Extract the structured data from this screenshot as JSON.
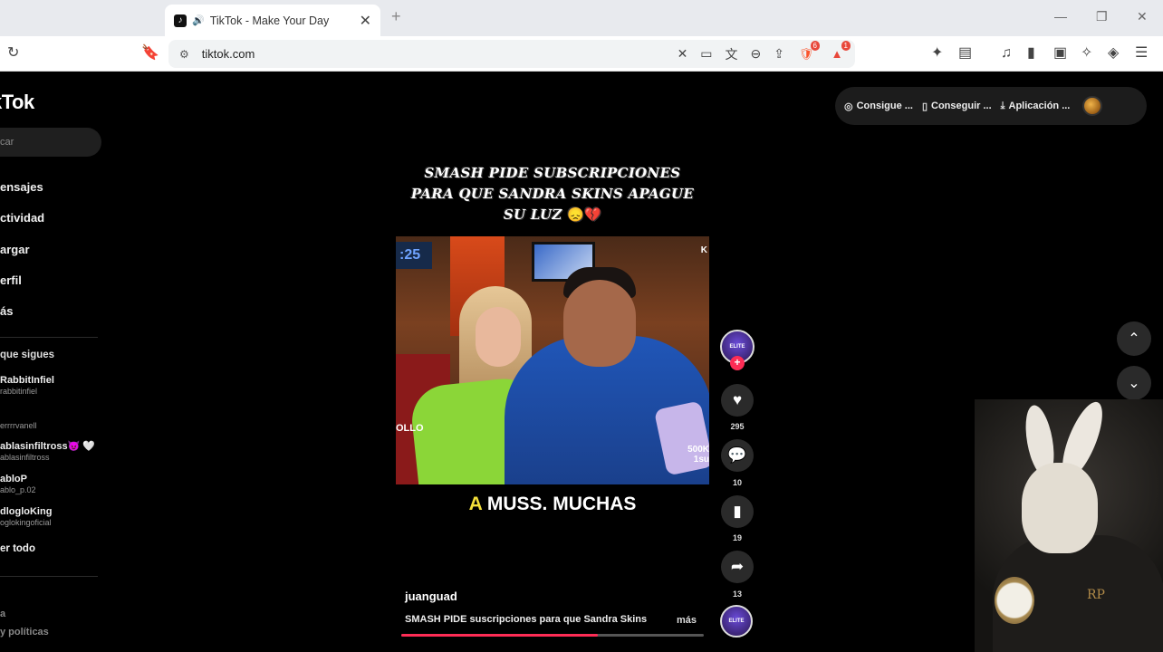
{
  "browser": {
    "tab_title": "TikTok - Make Your Day",
    "tab_close": "✕",
    "new_tab": "+",
    "url": "tiktok.com",
    "shield_badge": "6",
    "alert_badge": "1"
  },
  "sidebar": {
    "logo": "kTok",
    "search_placeholder": "car",
    "nav": [
      "ensajes",
      "ctividad",
      "argar",
      "erfil",
      "ás"
    ],
    "following_header": "que sigues",
    "accounts": [
      {
        "name": "RabbitInfiel",
        "handle": "rabbitinfiel"
      },
      {
        "name": "",
        "handle": "errrrvanell"
      },
      {
        "name": "ablasinfiltross😈 🤍",
        "handle": "ablasinfiltross"
      },
      {
        "name": "abloP",
        "handle": "ablo_p.02"
      },
      {
        "name": "dlogloKing",
        "handle": "oglokingoficial"
      }
    ],
    "see_all": "er todo",
    "footer_1": "a",
    "footer_2": "y políticas"
  },
  "top_actions": {
    "btn1": "Consigue ...",
    "btn2": "Conseguir ...",
    "btn3": "Aplicación ..."
  },
  "video": {
    "caption_line1": "SMASH PIDE SUBSCRIPCIONES",
    "caption_line2": "PARA QUE SANDRA SKINS APAGUE",
    "caption_line3": "SU LUZ",
    "caption_emoji": "😞💔",
    "scene_clock": ":25",
    "scene_tag_left": "OLLO",
    "scene_tag_right": "K",
    "scene_tag_right2": "500K\n1su",
    "subtitle_highlight": "A",
    "subtitle_rest": "MUSS. MUCHAS",
    "author": "juanguad",
    "description": "SMASH PIDE suscripciones para que Sandra Skins",
    "more": "más",
    "progress": 0.65
  },
  "rail": {
    "avatar_text": "ELITE",
    "likes": "295",
    "comments": "10",
    "saves": "19",
    "shares": "13"
  }
}
